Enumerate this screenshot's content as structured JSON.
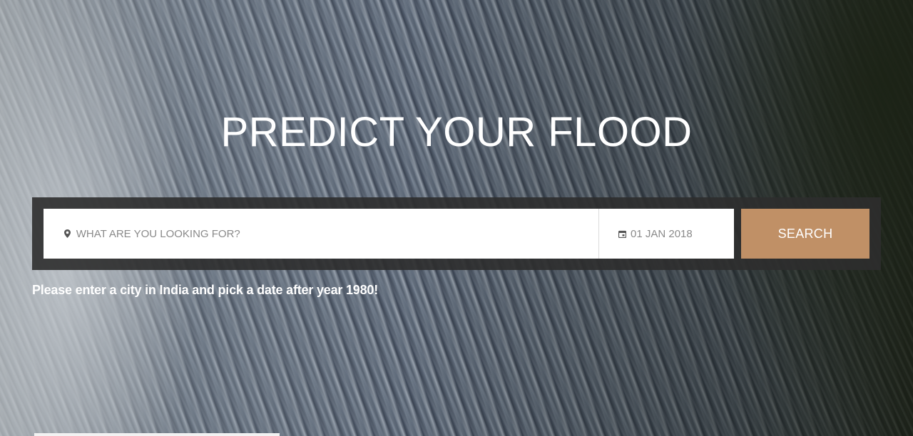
{
  "hero": {
    "title": "PREDICT YOUR FLOOD"
  },
  "search": {
    "location_placeholder": "WHAT ARE YOU LOOKING FOR?",
    "location_icon": "map-pin-icon",
    "date_value": "01 JAN 2018",
    "date_icon": "calendar-icon",
    "button_label": "SEARCH"
  },
  "hint": {
    "text": "Please enter a city in India and pick a date after year 1980!"
  },
  "colors": {
    "accent": "#c09066",
    "panel": "#2d2d2d",
    "text_on_dark": "#ffffff",
    "field_text": "#8a8a8a"
  }
}
